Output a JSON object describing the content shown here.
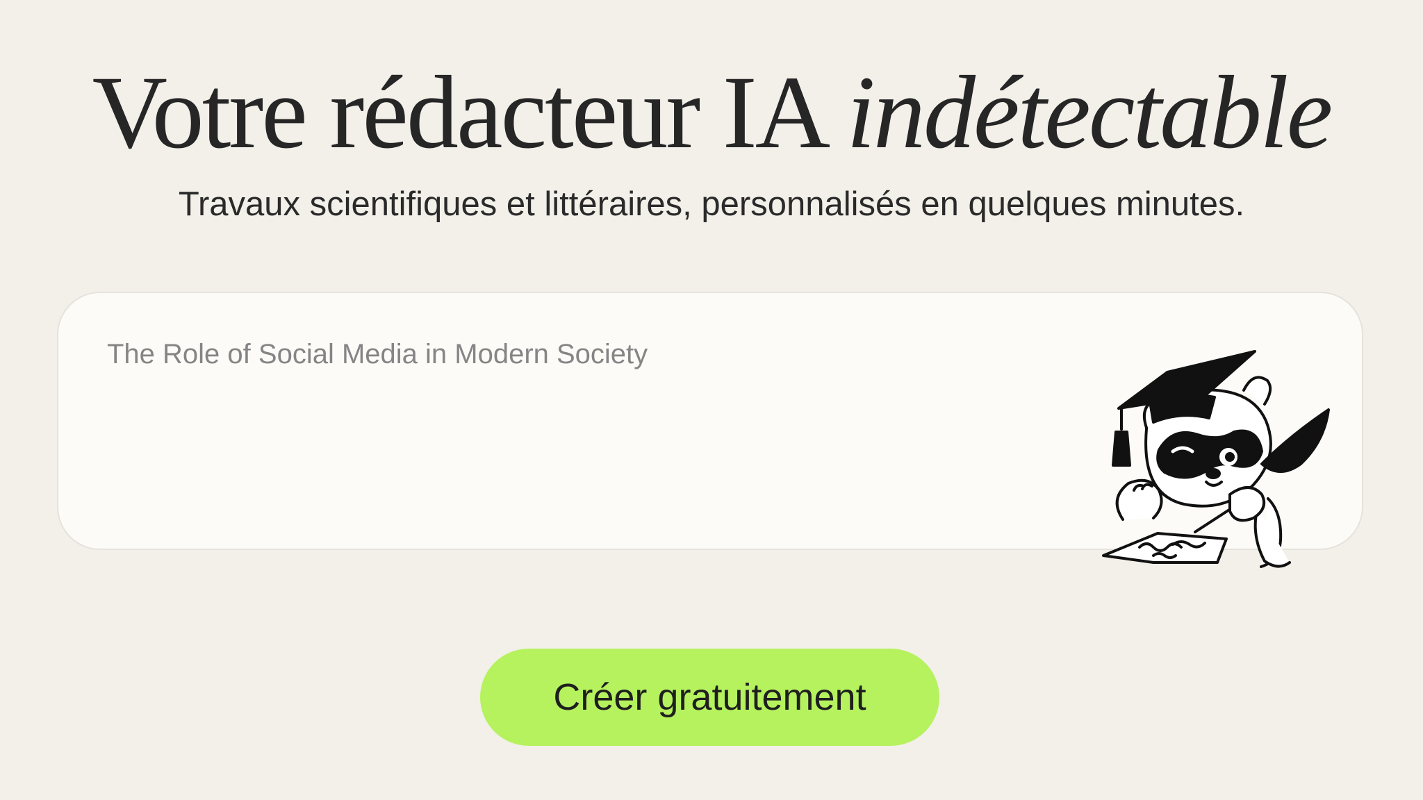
{
  "hero": {
    "title_main": "Votre rédacteur IA ",
    "title_emphasis": "indétectable",
    "subtitle": "Travaux scientifiques et littéraires, personnalisés en quelques minutes."
  },
  "topic_input": {
    "placeholder": "The Role of Social Media in Modern Society",
    "value": ""
  },
  "mascot": {
    "icon": "raccoon-graduate-writing-illustration"
  },
  "cta": {
    "label": "Créer gratuitement",
    "background_color": "#b5f25e"
  },
  "colors": {
    "page_background": "#f3efe9",
    "card_background": "#fcfbf8",
    "text_primary": "#262626",
    "placeholder_text": "#858585"
  }
}
